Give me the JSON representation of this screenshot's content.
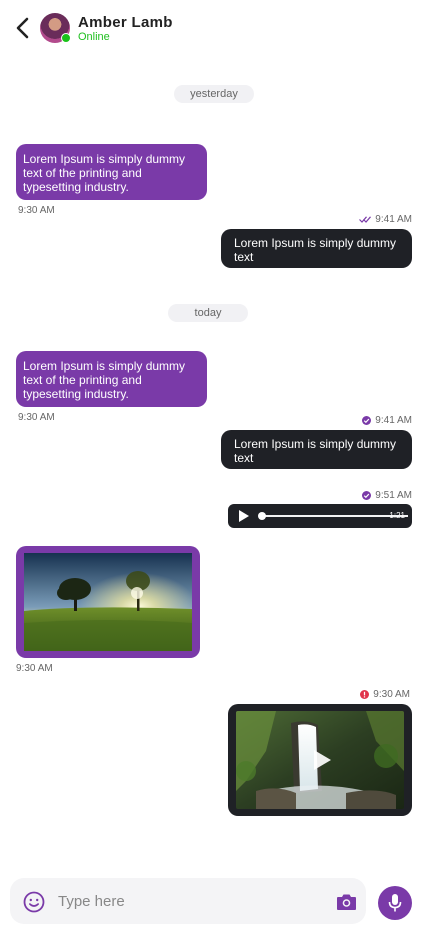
{
  "header": {
    "contact_name": "Amber Lamb",
    "status": "Online"
  },
  "separators": {
    "yesterday": "yesterday",
    "today": "today"
  },
  "messages": {
    "m1": {
      "text": "Lorem Ipsum is simply dummy text of the printing and typesetting industry.",
      "time": "9:30 AM"
    },
    "m2": {
      "text": "Lorem Ipsum is simply dummy text",
      "time": "9:41 AM",
      "status": "read"
    },
    "m3": {
      "text": "Lorem Ipsum is simply dummy text of the printing and typesetting industry.",
      "time": "9:30 AM"
    },
    "m4": {
      "text": "Lorem Ipsum is simply dummy text",
      "time": "9:41 AM",
      "status": "delivered"
    },
    "audio": {
      "duration": "1:21",
      "time": "9:51 AM",
      "status": "delivered",
      "progress": 0.0
    },
    "image": {
      "time": "9:30 AM"
    },
    "video": {
      "time": "9:30 AM",
      "status": "failed"
    }
  },
  "composer": {
    "placeholder": "Type here"
  },
  "icons": {
    "back": "back-arrow-icon",
    "emoji": "emoji-icon",
    "camera": "camera-icon",
    "mic": "microphone-icon",
    "play": "play-icon"
  },
  "colors": {
    "accent": "#7a3aa8",
    "outgoing_bubble": "#1f2126",
    "online": "#21c021",
    "error": "#e0344b"
  }
}
